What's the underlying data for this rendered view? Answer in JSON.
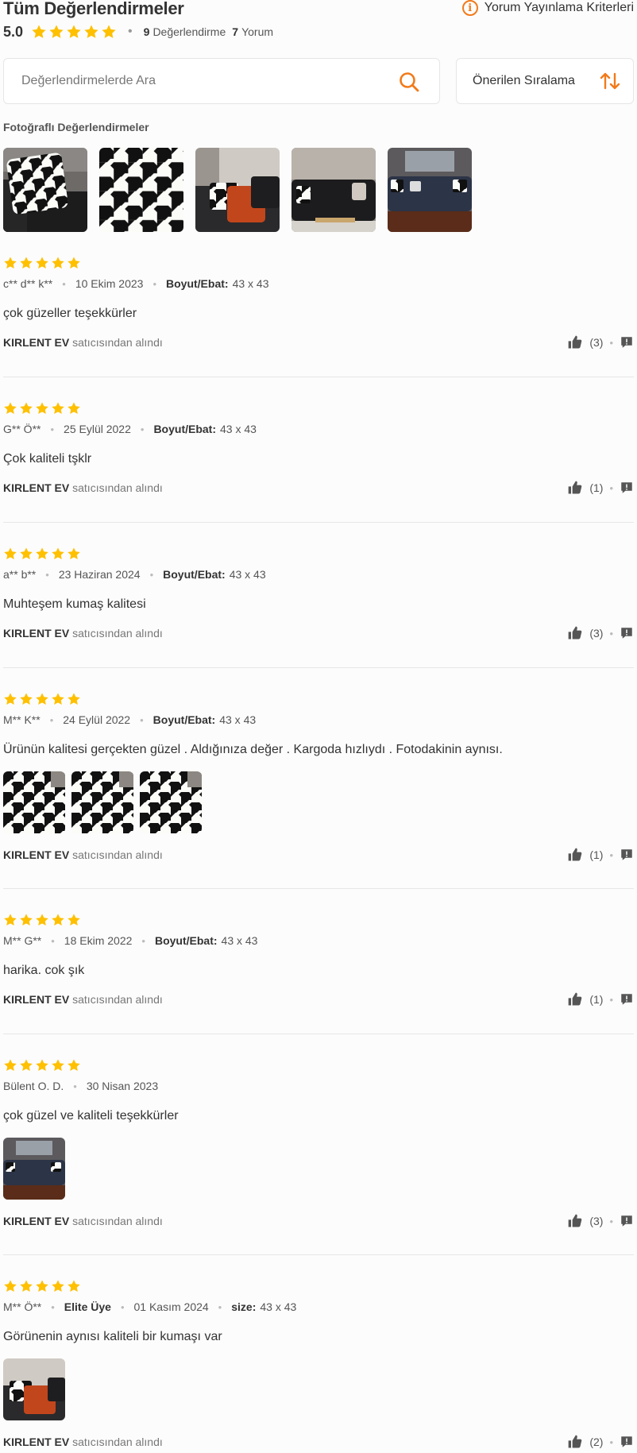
{
  "header": {
    "title": "Tüm Değerlendirmeler",
    "criteria_label": "Yorum Yayınlama Kriterleri",
    "rating": "5.0",
    "rating_count": "9",
    "rating_count_label": "Değerlendirme",
    "comment_count": "7",
    "comment_count_label": "Yorum"
  },
  "search": {
    "placeholder": "Değerlendirmelerde Ara"
  },
  "sort": {
    "label": "Önerilen Sıralama"
  },
  "photo_reviews": {
    "title": "Fotoğraflı Değerlendirmeler",
    "count": 5
  },
  "colors": {
    "accent": "#f27a1a",
    "star": "#ffc000",
    "text": "#333333"
  },
  "reviews": [
    {
      "stars": 5,
      "author": "c** d** k**",
      "date": "10 Ekim 2023",
      "attr_label": "Boyut/Ebat:",
      "attr_value": "43 x 43",
      "comment": "çok güzeller teşekkürler",
      "seller": "KIRLENT EV",
      "seller_suffix": "satıcısından alındı",
      "likes": "(3)"
    },
    {
      "stars": 5,
      "author": "G** Ö**",
      "date": "25 Eylül 2022",
      "attr_label": "Boyut/Ebat:",
      "attr_value": "43 x 43",
      "comment": "Çok kaliteli tşklr",
      "seller": "KIRLENT EV",
      "seller_suffix": "satıcısından alındı",
      "likes": "(1)"
    },
    {
      "stars": 5,
      "author": "a** b**",
      "date": "23 Haziran 2024",
      "attr_label": "Boyut/Ebat:",
      "attr_value": "43 x 43",
      "comment": "Muhteşem kumaş kalitesi",
      "seller": "KIRLENT EV",
      "seller_suffix": "satıcısından alındı",
      "likes": "(3)"
    },
    {
      "stars": 5,
      "author": "M** K**",
      "date": "24 Eylül 2022",
      "attr_label": "Boyut/Ebat:",
      "attr_value": "43 x 43",
      "comment": "Ürünün kalitesi gerçekten güzel . Aldığınıza değer . Kargoda hızlıydı . Fotodakinin aynısı.",
      "seller": "KIRLENT EV",
      "seller_suffix": "satıcısından alındı",
      "likes": "(1)"
    },
    {
      "stars": 5,
      "author": "M** G**",
      "date": "18 Ekim 2022",
      "attr_label": "Boyut/Ebat:",
      "attr_value": "43 x 43",
      "comment": "harika. cok şık",
      "seller": "KIRLENT EV",
      "seller_suffix": "satıcısından alındı",
      "likes": "(1)"
    },
    {
      "stars": 5,
      "author": "Bülent O. D.",
      "date": "30 Nisan 2023",
      "comment": "çok güzel ve kaliteli teşekkürler",
      "seller": "KIRLENT EV",
      "seller_suffix": "satıcısından alındı",
      "likes": "(3)"
    },
    {
      "stars": 5,
      "author": "M** Ö**",
      "badge": "Elite Üye",
      "date": "01 Kasım 2024",
      "attr_label": "size:",
      "attr_value": "43 x 43",
      "comment": "Görünenin aynısı kaliteli bir kumaşı var",
      "seller": "KIRLENT EV",
      "seller_suffix": "satıcısından alındı",
      "likes": "(2)"
    }
  ]
}
